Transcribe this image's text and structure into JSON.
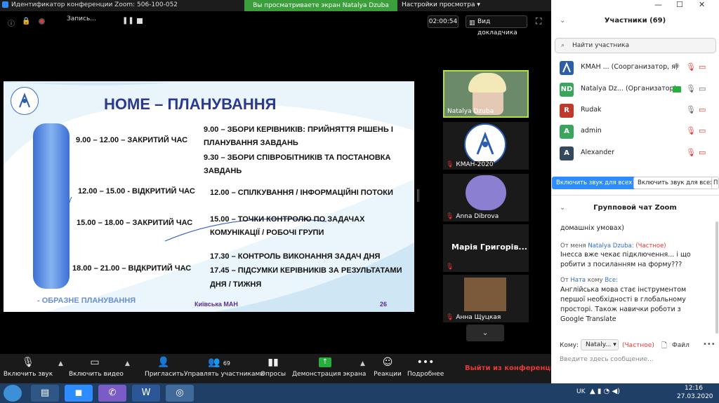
{
  "window": {
    "title": "Идентификатор конференции Zoom: 506-100-052",
    "share_banner": "Вы просматриваете экран Natalya  Dzuba",
    "view_settings": "Настройки просмотра",
    "minimize": "—",
    "maximize": "☐",
    "close": "✕"
  },
  "meeting_bar": {
    "recording": "Запись...",
    "timer": "02:00:54",
    "speaker_view": "Вид докладчика"
  },
  "slide": {
    "title": "HOME – ПЛАНУВАННЯ",
    "left_times": [
      "9.00 – 12.00  – ЗАКРИТИЙ ЧАС",
      "12.00 – 15.00  - ВІДКРИТИЙ ЧАС",
      "15.00 – 18.00  – ЗАКРИТИЙ ЧАС",
      "18.00 – 21.00  – ВІДКРИТИЙ ЧАС"
    ],
    "right_lines": [
      "9.00 – ЗБОРИ КЕРІВНИКІВ: ПРИЙНЯТТЯ РІШЕНЬ І",
      "ПЛАНУВАННЯ ЗАВДАНЬ",
      "9.30 – ЗБОРИ СПІВРОБІТНИКІВ ТА ПОСТАНОВКА",
      "ЗАВДАНЬ",
      "12.00 – СПІЛКУВАННЯ / ІНФОРМАЦІЙНІ ПОТОКИ",
      "15.00 – ТОЧКИ КОНТРОЛЮ ПО ЗАДАЧАХ",
      "КОМУНІКАЦІЇ / РОБОЧІ ГРУПИ",
      "17.30 – КОНТРОЛЬ ВИКОНАННЯ ЗАДАЧ ДНЯ",
      "17.45 – ПІДСУМКИ КЕРІВНИКІВ ЗА РЕЗУЛЬТАТАМИ",
      "ДНЯ / ТИЖНЯ"
    ],
    "footer_left": "- ОБРАЗНЕ ПЛАНУВАННЯ",
    "footer_center": "Київська МАН",
    "page": "26"
  },
  "thumbnails": [
    {
      "name": "Natalya  Dzuba"
    },
    {
      "name": "КМАН-2020"
    },
    {
      "name": "Anna Dibrova"
    },
    {
      "name": "Марія  Григорів..."
    },
    {
      "name": "Анна Щуцкая"
    }
  ],
  "toolbar": {
    "unmute": "Включить звук",
    "start_video": "Включить видео",
    "invite": "Пригласить",
    "participants": "Управлять участниками",
    "participants_count": "69",
    "polls": "Опросы",
    "share": "Демонстрация экрана",
    "reactions": "Реакции",
    "more": "Подробнее",
    "leave": "Выйти из конференции"
  },
  "panel": {
    "title": "Участники (69)",
    "search_placeholder": "Найти участника",
    "participants": [
      {
        "initials": "",
        "name": "КМАН ...  (Соорганизатор, я)",
        "color": "#2d5ea8"
      },
      {
        "initials": "ND",
        "name": "Natalya  Dz...  (Организатор)",
        "color": "#3aa55d"
      },
      {
        "initials": "R",
        "name": "Rudak",
        "color": "#c0392b"
      },
      {
        "initials": "A",
        "name": "admin",
        "color": "#3aa55d"
      },
      {
        "initials": "A",
        "name": "Alexander",
        "color": "#34495e"
      }
    ],
    "unmute_all": "Включить звук для всех",
    "mute_all": "Включить звук для всех",
    "more_btn": "П"
  },
  "chat": {
    "title": "Групповой чат Zoom",
    "clipped_line": "домашніх умовах)",
    "msg1_prefix": "От меня",
    "msg1_to": "Natalya  Dzuba:",
    "msg1_private": "(Частное)",
    "msg1_lines": [
      "Інесса вже чекає підключення... і що",
      "робити з посиланням на форму???"
    ],
    "msg2_prefix": "От",
    "msg2_from": "Ната",
    "msg2_mid": "кому",
    "msg2_to": "Все:",
    "msg2_lines": [
      "Англійська мова стає інструментом",
      "першої необхідності в глобальному",
      "просторі. Також навички роботи з",
      "Google Translate"
    ],
    "to_label": "Кому:",
    "to_value": "Nataly...",
    "to_private": "(Частное)",
    "file": "Файл",
    "input_placeholder": "Введите здесь сообщение..."
  },
  "taskbar": {
    "lang": "UK",
    "time": "12:16",
    "date": "27.03.2020"
  }
}
